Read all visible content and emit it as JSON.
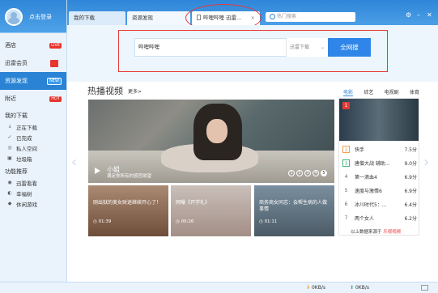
{
  "user": {
    "login_text": "点击登录"
  },
  "sidebar": {
    "items": [
      {
        "label": "酒店",
        "badge": "LIVE"
      },
      {
        "label": "迅雷会员"
      },
      {
        "label": "资源发现",
        "badge": "NEW"
      },
      {
        "label": "附近",
        "badge": "HOT"
      }
    ],
    "downloads_title": "我的下载",
    "downloads": [
      {
        "icon": "↓",
        "label": "正在下载"
      },
      {
        "icon": "✓",
        "label": "已完成"
      },
      {
        "icon": "◎",
        "label": "私人空间"
      },
      {
        "icon": "▣",
        "label": "垃圾箱"
      }
    ],
    "features_title": "功能推荐",
    "features": [
      {
        "icon": "◉",
        "label": "迅雷看看"
      },
      {
        "icon": "◐",
        "label": "幸福树"
      },
      {
        "icon": "◆",
        "label": "休闲游戏"
      }
    ]
  },
  "tabs": [
    {
      "label": "我的下载"
    },
    {
      "label": "资源发现"
    },
    {
      "label": "哔哩哔哩 迅雷..."
    }
  ],
  "top_search": {
    "placeholder": "热门搜索"
  },
  "main_search": {
    "value": "哔哩哔哩",
    "engine": "迅雷下载",
    "button": "全网搜"
  },
  "hot": {
    "title": "热播视频",
    "more": "更多>",
    "feature": {
      "title": "小姐",
      "subtitle": "满足你所有的感官欲望"
    },
    "dots": [
      "1",
      "2",
      "3",
      "4",
      "5"
    ],
    "cards": [
      {
        "text": "刚出狱的美女财迷继续开心了！",
        "time": "01:39"
      },
      {
        "text": "网曝《开学礼》",
        "time": "00:26"
      },
      {
        "text": "商务商女同志：会帮生病的人做事情",
        "time": "01:11"
      }
    ]
  },
  "ranking": {
    "tabs": [
      "电影",
      "综艺",
      "电视剧",
      "体育"
    ],
    "active_tab": "电影",
    "rows": [
      {
        "rank": "1"
      },
      {
        "rank": "2",
        "name": "快手",
        "score": "7.5分"
      },
      {
        "rank": "3",
        "name": "唐僧大战 辅助...",
        "score": "9.0分"
      },
      {
        "rank": "4",
        "name": "第一滴血4",
        "score": "6.9分"
      },
      {
        "rank": "5",
        "name": "速度与激情6",
        "score": "6.9分"
      },
      {
        "rank": "6",
        "name": "冰川时代5：...",
        "score": "6.4分"
      },
      {
        "rank": "7",
        "name": "两个女人",
        "score": "6.2分"
      }
    ],
    "footer_prefix": "以上数据来源于",
    "footer_brand": "乐视视频"
  },
  "status": {
    "upload": "0KB/s",
    "download": "0KB/s"
  }
}
